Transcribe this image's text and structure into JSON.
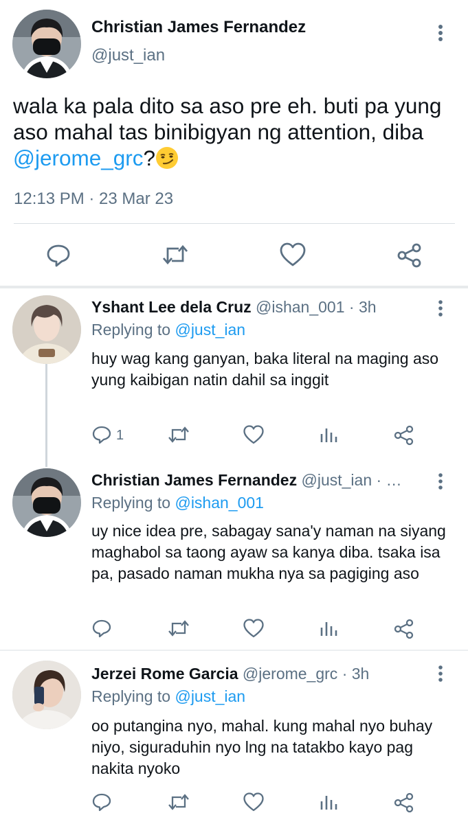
{
  "main_tweet": {
    "name": "Christian James Fernandez",
    "handle": "@just_ian",
    "text_before": "wala ka pala dito sa aso pre eh. buti pa yung aso mahal tas binibigyan ng attention, diba ",
    "mention": "@jerome_grc",
    "text_after": "?",
    "emoji": "smirking-face",
    "timestamp": "12:13 PM · 23 Mar 23",
    "actions": [
      "reply-icon",
      "retweet-icon",
      "like-icon",
      "share-icon"
    ]
  },
  "replies": [
    {
      "name": "Yshant Lee dela Cruz",
      "meta": "@ishan_001 · 3h",
      "replying_label": "Replying to",
      "replying_to": "@just_ian",
      "text": "huy wag kang ganyan, baka literal na maging aso yung kaibigan natin dahil sa inggit",
      "reply_count": "1"
    },
    {
      "name": "Christian James Fernandez",
      "meta": "@just_ian · …",
      "replying_label": "Replying to",
      "replying_to": "@ishan_001",
      "text": "uy nice idea pre, sabagay sana'y naman na siyang maghabol sa taong ayaw sa kanya diba. tsaka isa pa, pasado naman mukha nya sa pagiging aso",
      "reply_count": ""
    },
    {
      "name": "Jerzei Rome Garcia",
      "meta": "@jerome_grc · 3h",
      "replying_label": "Replying to",
      "replying_to": "@just_ian",
      "text": "oo putangina nyo, mahal. kung mahal nyo buhay niyo, siguraduhin nyo lng na tatakbo kayo pag nakita nyoko",
      "reply_count": ""
    }
  ],
  "colors": {
    "link": "#1d9bf0",
    "secondary_text": "#5b7083",
    "icon": "#5b7083",
    "divider": "#d9dee3"
  }
}
